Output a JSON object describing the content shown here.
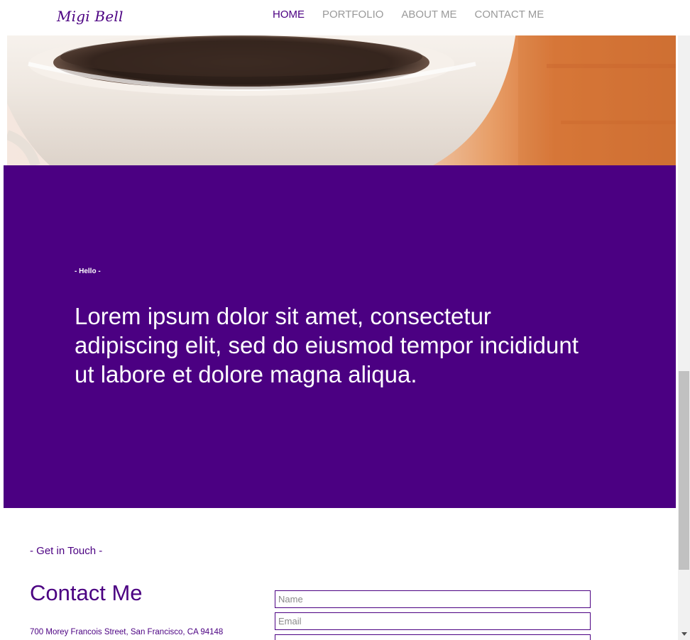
{
  "header": {
    "logo": "Migi Bell",
    "nav": [
      {
        "label": "HOME",
        "active": true
      },
      {
        "label": "PORTFOLIO",
        "active": false
      },
      {
        "label": "ABOUT ME",
        "active": false
      },
      {
        "label": "CONTACT ME",
        "active": false
      }
    ]
  },
  "hero": {
    "image_subject": "coffee-cup"
  },
  "intro": {
    "eyebrow": "- Hello -",
    "text": "Lorem ipsum dolor sit amet, consectetur adipiscing elit, sed do eiusmod tempor incididunt ut labore et dolore magna aliqua."
  },
  "contact": {
    "eyebrow": "- Get in Touch -",
    "title": "Contact Me",
    "address": "700 Morey Francois Street, San Francisco, CA 94148",
    "form": {
      "name_placeholder": "Name",
      "email_placeholder": "Email"
    }
  },
  "colors": {
    "accent": "#4b0082",
    "nav_inactive": "#9a9a9a",
    "background": "#ffffff"
  }
}
